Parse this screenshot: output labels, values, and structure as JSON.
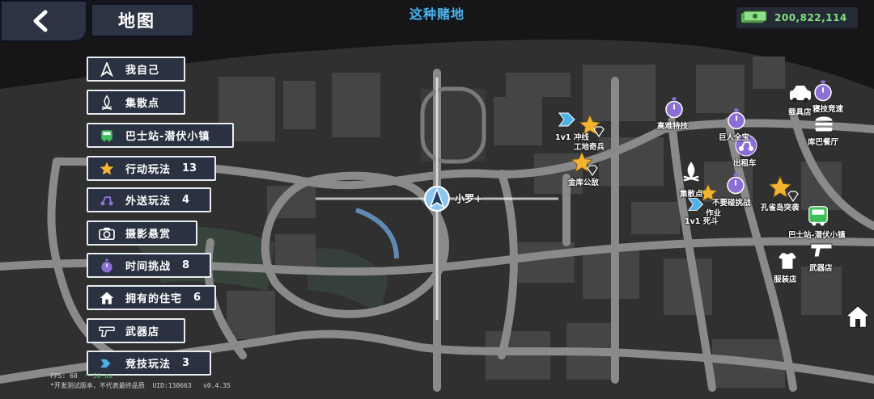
{
  "header": {
    "title": "地图",
    "hint": "这种赌地"
  },
  "currency": {
    "amount": "200,822,114"
  },
  "legend": [
    {
      "label": "我自己",
      "count": "",
      "icon": "player-arrow-icon"
    },
    {
      "label": "集散点",
      "count": "",
      "icon": "campfire-icon"
    },
    {
      "label": "巴士站-潜伏小镇",
      "count": "",
      "icon": "bus-icon"
    },
    {
      "label": "行动玩法",
      "count": "13",
      "icon": "star-icon"
    },
    {
      "label": "外送玩法",
      "count": "4",
      "icon": "scooter-icon"
    },
    {
      "label": "摄影悬赏",
      "count": "",
      "icon": "camera-icon"
    },
    {
      "label": "时间挑战",
      "count": "8",
      "icon": "stopwatch-icon"
    },
    {
      "label": "拥有的住宅",
      "count": "6",
      "icon": "house-icon"
    },
    {
      "label": "武器店",
      "count": "",
      "icon": "gun-icon"
    },
    {
      "label": "竞技玩法",
      "count": "3",
      "icon": "versus-icon"
    }
  ],
  "player": {
    "label": "小罗+"
  },
  "map_labels": [
    {
      "text": "1v1 冲线",
      "name": "label-1v1-chongxian"
    },
    {
      "text": "工地奇兵",
      "name": "label-gongdi-qibing"
    },
    {
      "text": "金库公敌",
      "name": "label-jinku-gongdi"
    },
    {
      "text": "高难特技",
      "name": "label-gaonan-teji"
    },
    {
      "text": "巨人全宝",
      "name": "label-juren"
    },
    {
      "text": "出租车",
      "name": "label-chuzuche"
    },
    {
      "text": "载具店",
      "name": "label-zaijudian"
    },
    {
      "text": "寝技竞速",
      "name": "label-jingsu"
    },
    {
      "text": "库巴餐厅",
      "name": "label-kuba-canting"
    },
    {
      "text": "集散点",
      "name": "label-jisandian"
    },
    {
      "text": "作业",
      "name": "label-zuoye"
    },
    {
      "text": "不要碰挑战",
      "name": "label-buyaopeng"
    },
    {
      "text": "1v1 死斗",
      "name": "label-1v1-sidou"
    },
    {
      "text": "孔雀岛突袭",
      "name": "label-kongquedao"
    },
    {
      "text": "巴士站-潜伏小镇",
      "name": "label-bus-stop"
    },
    {
      "text": "武器店",
      "name": "label-wuqidian"
    },
    {
      "text": "服装店",
      "name": "label-fuzhuangdian"
    }
  ],
  "debug": {
    "fps_label": "FPS: 60",
    "net": "50 ms",
    "note": "*开发测试版本，不代表最终品质",
    "uid": "UID:130663",
    "version": "v0.4.35"
  },
  "colors": {
    "accent_blue": "#4fb0e8",
    "money_green": "#7de07a",
    "star": "#f3b531",
    "purple": "#8b6fd6"
  }
}
